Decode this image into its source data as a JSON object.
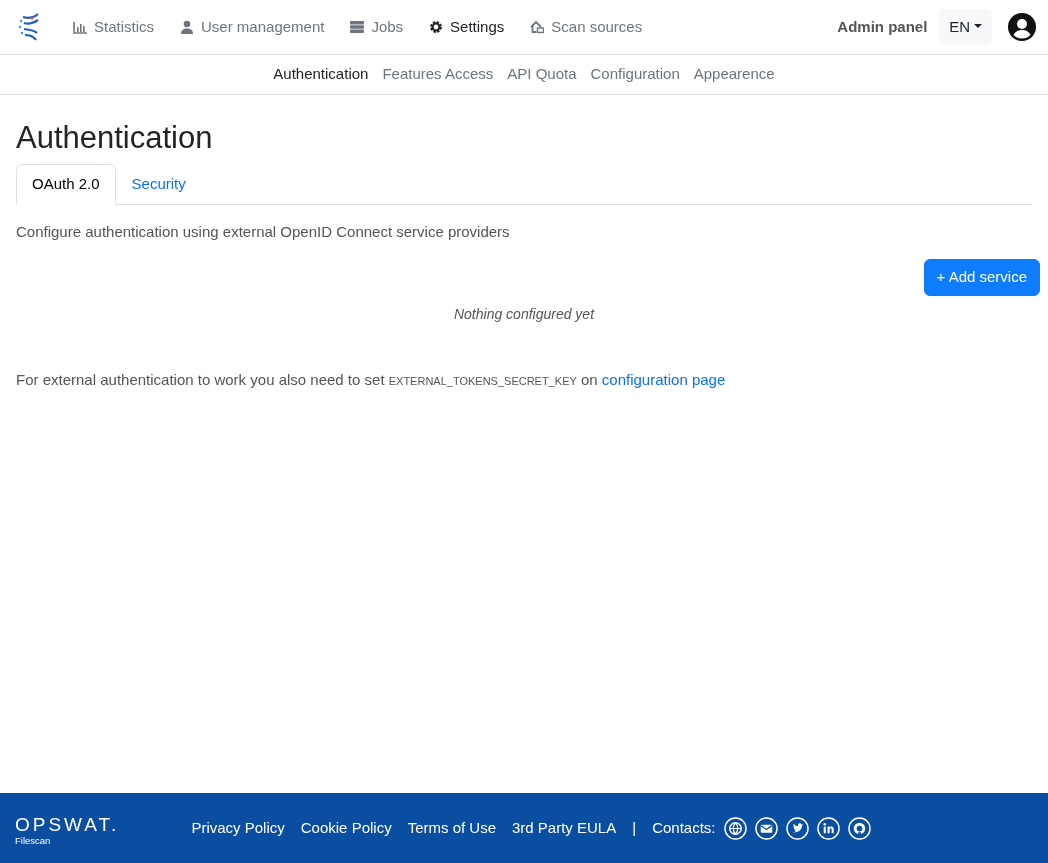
{
  "navbar": {
    "items": [
      {
        "label": "Statistics",
        "selected": false
      },
      {
        "label": "User management",
        "selected": false
      },
      {
        "label": "Jobs",
        "selected": false
      },
      {
        "label": "Settings",
        "selected": true
      },
      {
        "label": "Scan sources",
        "selected": false
      }
    ],
    "admin_label": "Admin panel",
    "language": "EN"
  },
  "subnav": [
    {
      "label": "Authentication",
      "selected": true
    },
    {
      "label": "Features Access",
      "selected": false
    },
    {
      "label": "API Quota",
      "selected": false
    },
    {
      "label": "Configuration",
      "selected": false
    },
    {
      "label": "Appearence",
      "selected": false
    }
  ],
  "page_title": "Authentication",
  "tabs": [
    {
      "label": "OAuth 2.0",
      "selected": true
    },
    {
      "label": "Security",
      "selected": false
    }
  ],
  "description": "Configure authentication using external OpenID Connect service providers",
  "add_button": "+ Add service",
  "empty_text": "Nothing configured yet",
  "note": {
    "before": "For external authentication to work you also need to set",
    "code": "EXTERNAL_TOKENS_SECRET_KEY",
    "middle": "on",
    "link": "configuration page"
  },
  "footer": {
    "brand": "OPSWAT.",
    "product": "Filescan",
    "links": [
      "Privacy Policy",
      "Cookie Policy",
      "Terms of Use",
      "3rd Party EULA"
    ],
    "separator": "|",
    "contacts_label": "Contacts:"
  }
}
